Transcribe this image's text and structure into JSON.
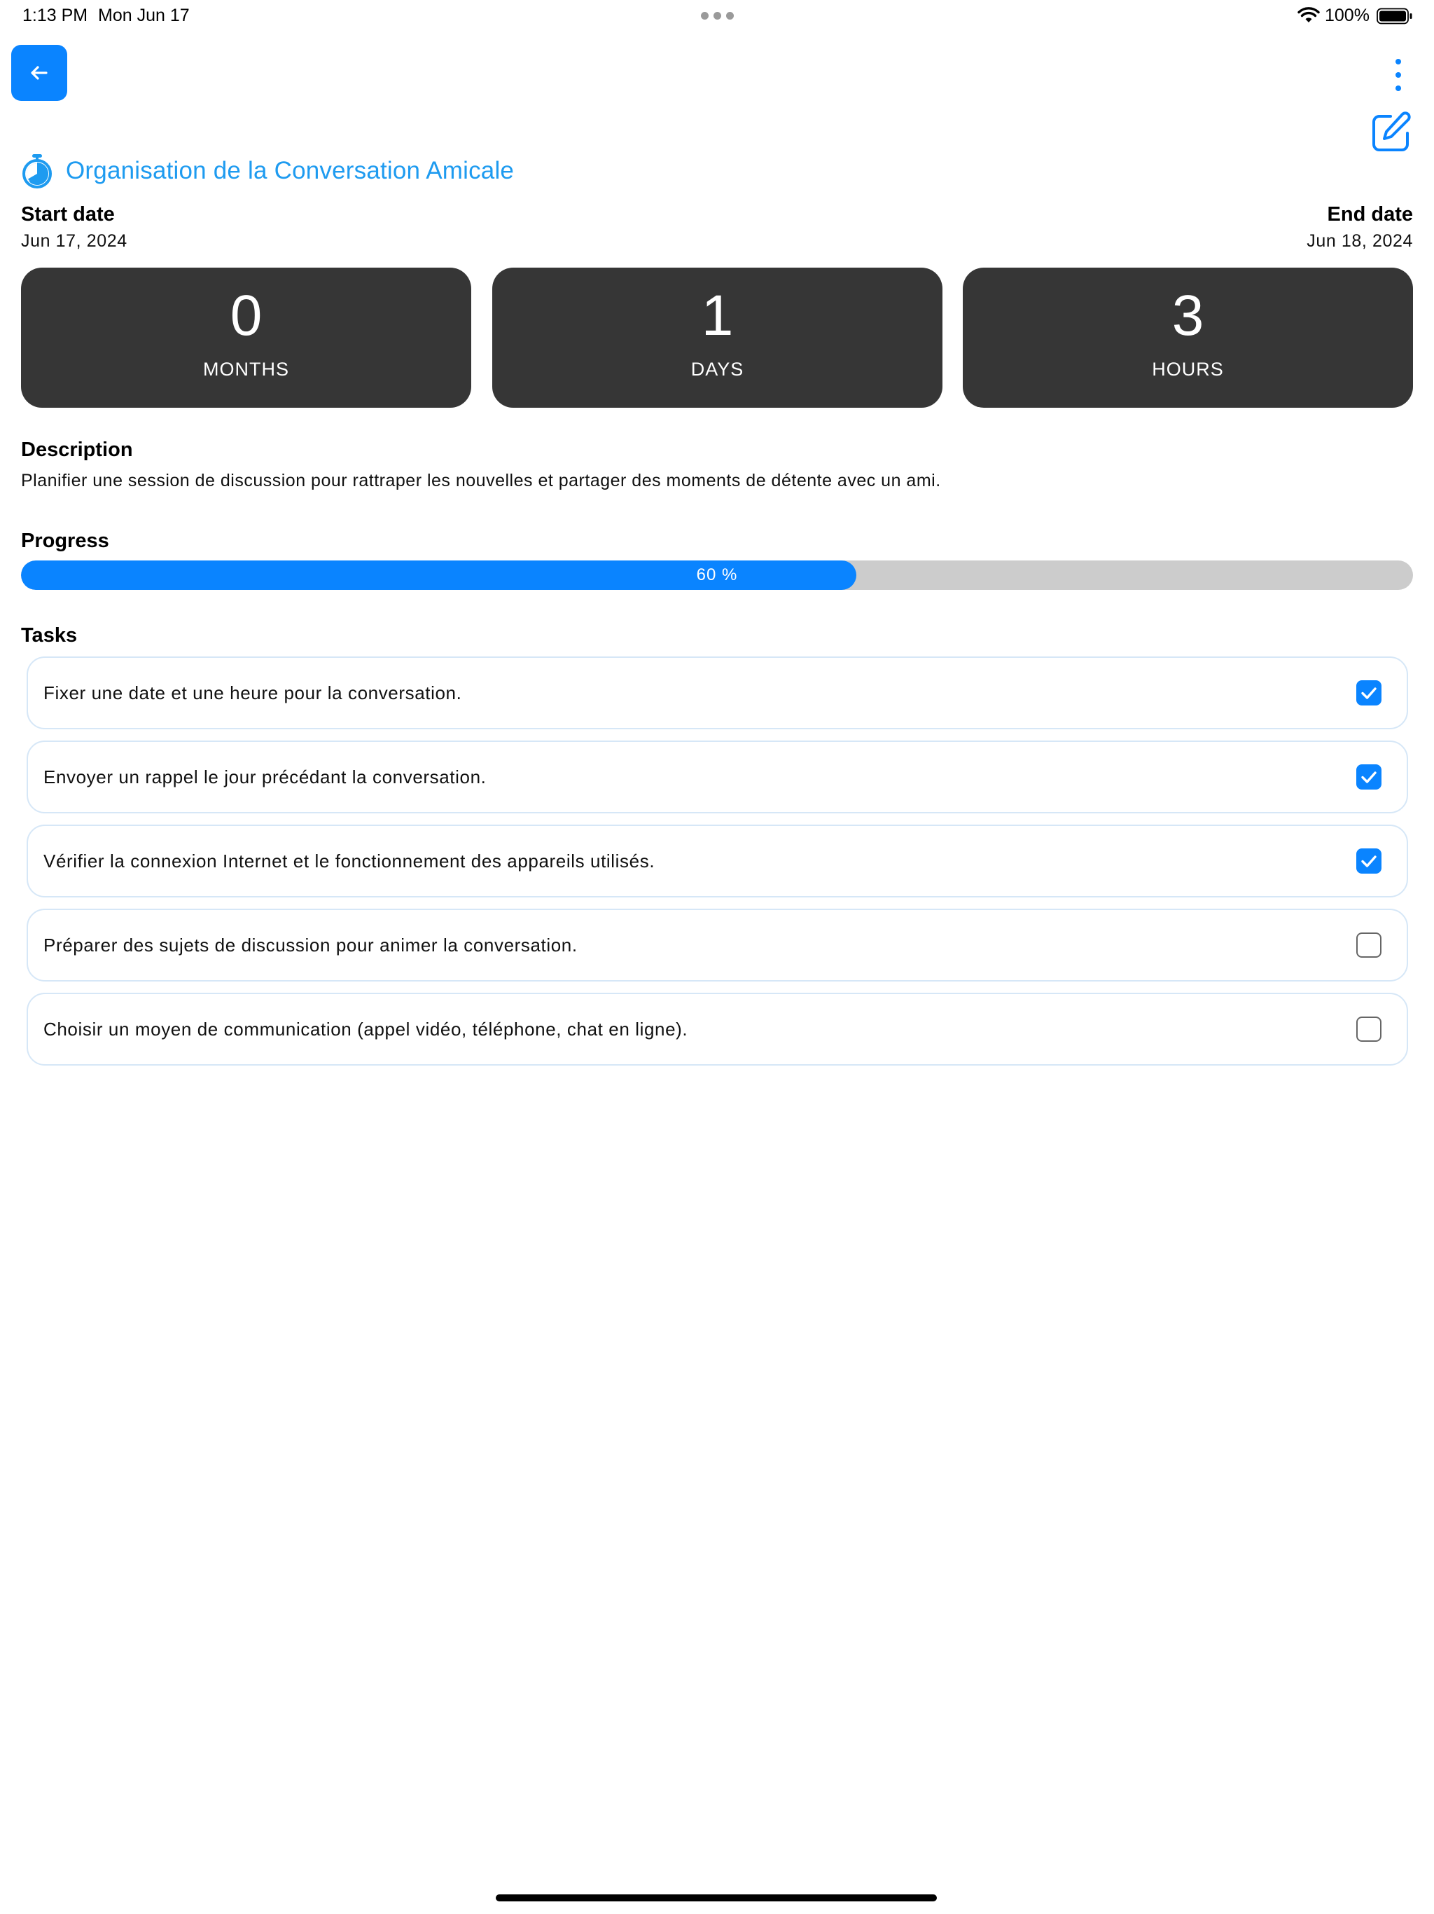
{
  "status_bar": {
    "time": "1:13 PM",
    "date": "Mon Jun 17",
    "battery": "100%"
  },
  "header": {
    "back_icon": "arrow-left-icon",
    "more_icon": "more-vertical-icon",
    "edit_icon": "edit-pen-icon"
  },
  "project": {
    "title_icon": "timer-icon",
    "title": "Organisation de la Conversation Amicale",
    "start_label": "Start date",
    "start_value": "Jun 17, 2024",
    "end_label": "End date",
    "end_value": "Jun 18, 2024"
  },
  "countdown": {
    "months": {
      "value": "0",
      "unit": "MONTHS"
    },
    "days": {
      "value": "1",
      "unit": "DAYS"
    },
    "hours": {
      "value": "3",
      "unit": "HOURS"
    }
  },
  "description": {
    "heading": "Description",
    "text": "Planifier une session de discussion pour rattraper les nouvelles et partager des moments de détente avec un ami."
  },
  "progress": {
    "heading": "Progress",
    "percent": 60,
    "label": "60 %"
  },
  "tasks": {
    "heading": "Tasks",
    "items": [
      {
        "label": "Fixer une date et une heure pour la conversation.",
        "checked": true
      },
      {
        "label": "Envoyer un rappel le jour précédant la conversation.",
        "checked": true
      },
      {
        "label": "Vérifier la connexion Internet et le fonctionnement des appareils utilisés.",
        "checked": true
      },
      {
        "label": "Préparer des sujets de discussion pour animer la conversation.",
        "checked": false
      },
      {
        "label": "Choisir un moyen de communication (appel vidéo, téléphone, chat en ligne).",
        "checked": false
      }
    ]
  },
  "colors": {
    "accent": "#0a84ff",
    "title": "#1e9bf0",
    "card_background": "#363636",
    "progress_track": "#cccccc",
    "task_border": "#d6e7f7"
  }
}
